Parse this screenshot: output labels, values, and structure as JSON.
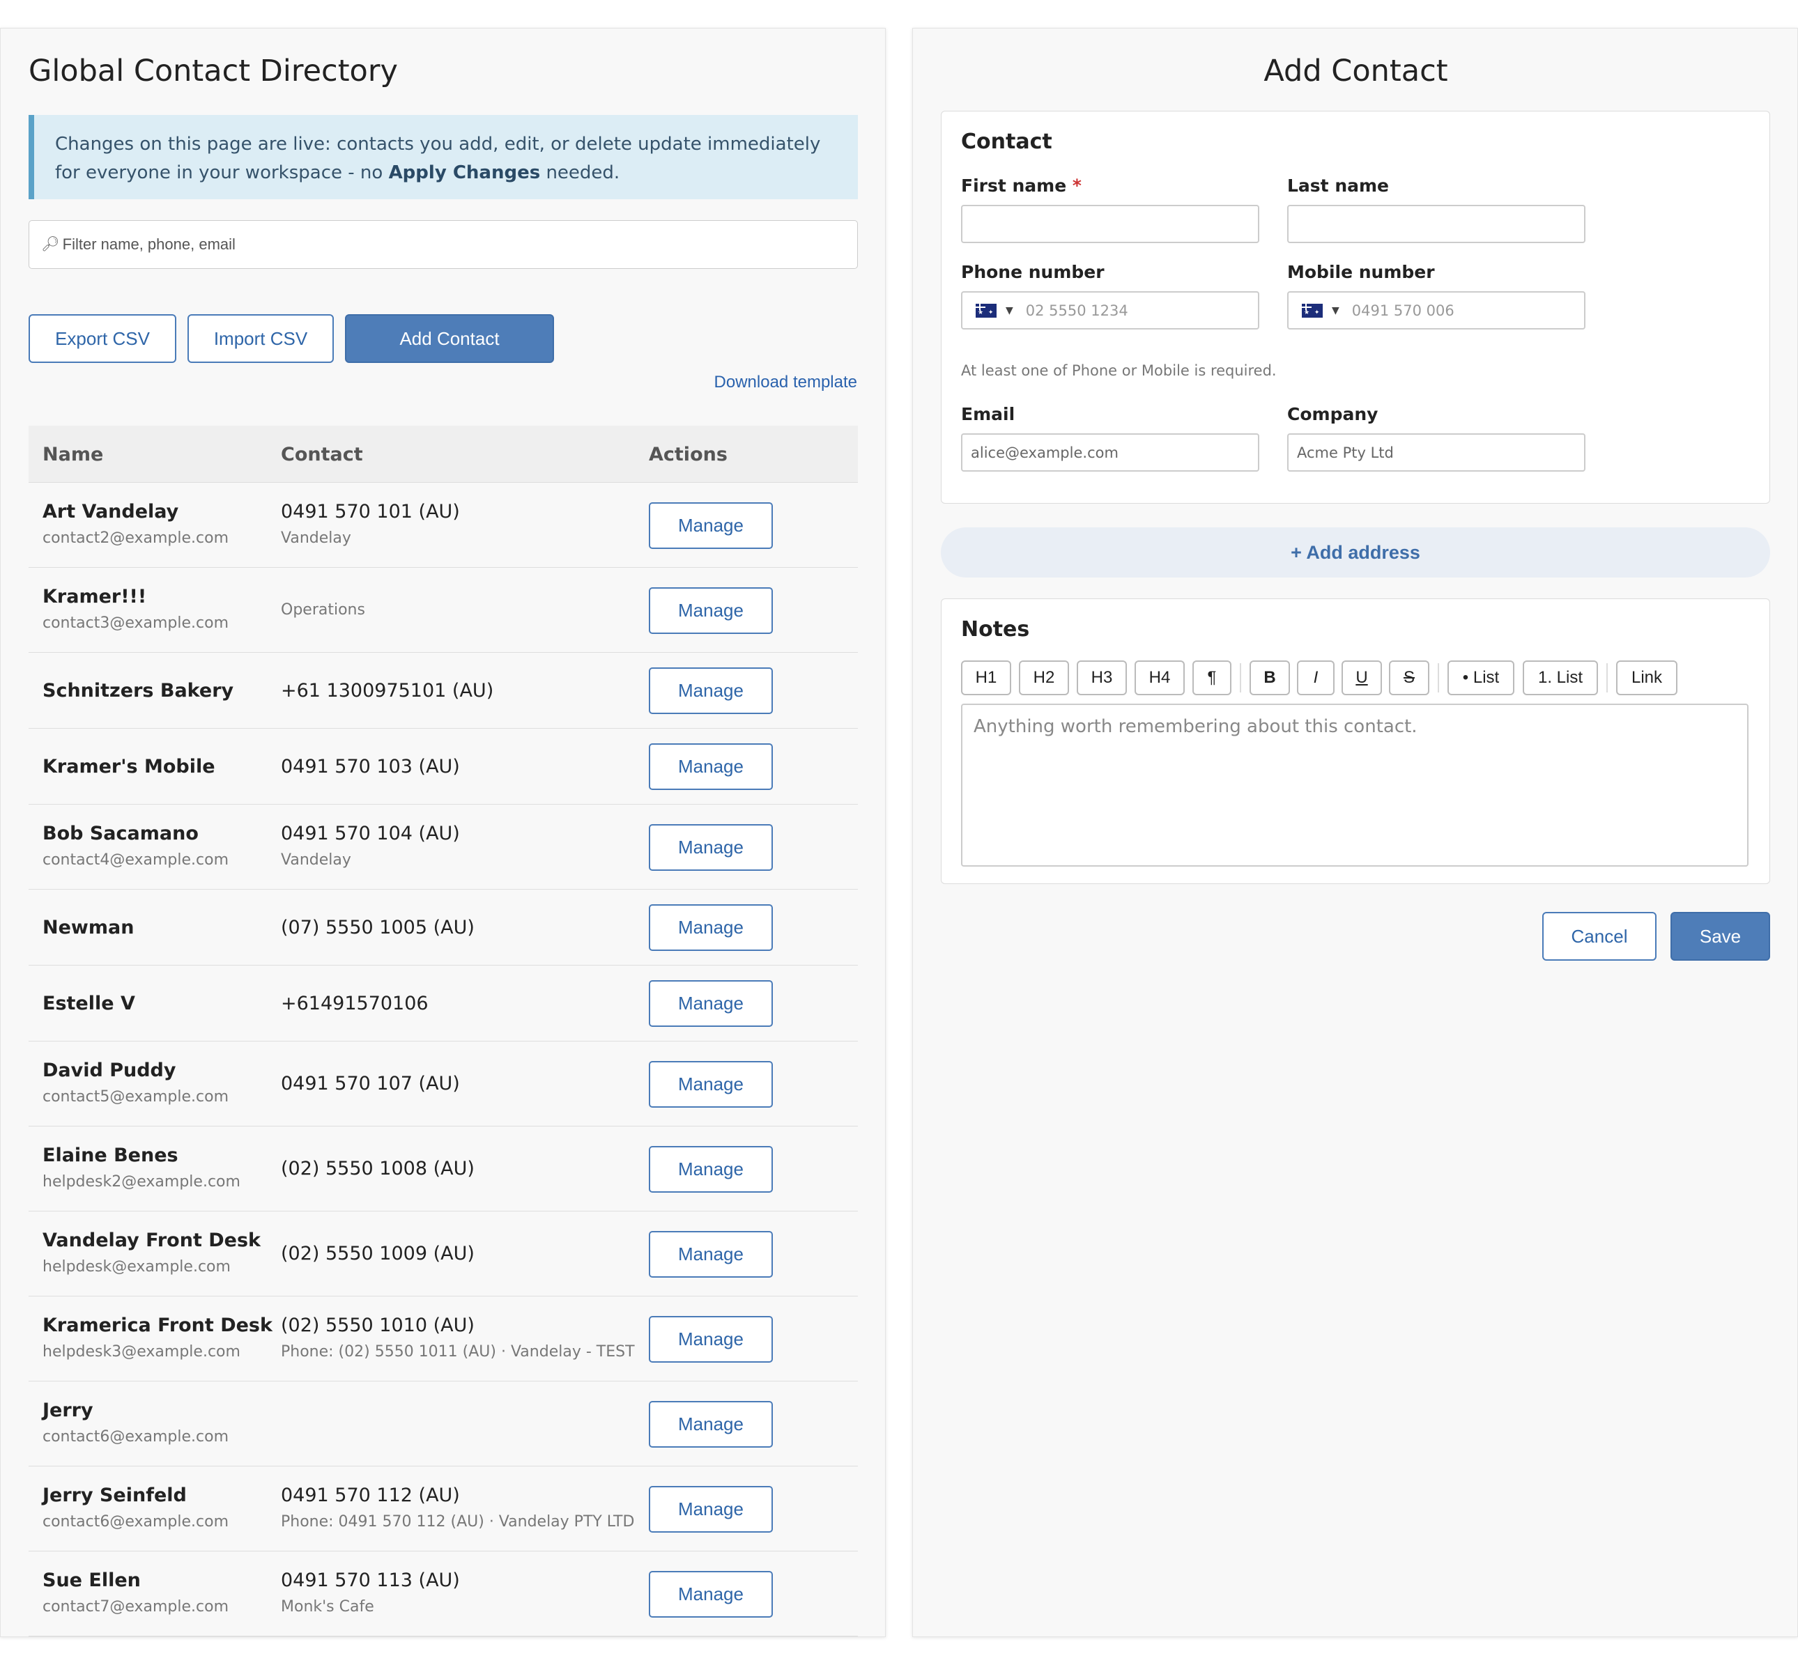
{
  "directory": {
    "title": "Global Contact Directory",
    "info": {
      "text_before": "Changes on this page are live: contacts you add, edit, or delete update immediately for everyone in your workspace - no ",
      "bold": "Apply Changes",
      "text_after": " needed."
    },
    "filter": {
      "placeholder": "Filter name, phone, email",
      "value": ""
    },
    "buttons": {
      "export": "Export CSV",
      "import": "Import CSV",
      "add": "Add Contact"
    },
    "download_template": "Download template",
    "columns": [
      "Name",
      "Contact",
      "Actions"
    ],
    "manage_label": "Manage",
    "contacts": [
      {
        "name": "Art Vandelay",
        "email": "contact2@example.com",
        "phone": "0491 570 101 (AU)",
        "detail": "Vandelay"
      },
      {
        "name": "Kramer!!!",
        "email": "contact3@example.com",
        "phone": "",
        "detail": "Operations"
      },
      {
        "name": "Schnitzers Bakery",
        "email": "",
        "phone": "+61 1300975101 (AU)",
        "detail": ""
      },
      {
        "name": "Kramer's Mobile",
        "email": "",
        "phone": "0491 570 103 (AU)",
        "detail": ""
      },
      {
        "name": "Bob Sacamano",
        "email": "contact4@example.com",
        "phone": "0491 570 104 (AU)",
        "detail": "Vandelay"
      },
      {
        "name": "Newman",
        "email": "",
        "phone": "(07) 5550 1005 (AU)",
        "detail": ""
      },
      {
        "name": "Estelle V",
        "email": "",
        "phone": "+61491570106",
        "detail": ""
      },
      {
        "name": "David Puddy",
        "email": "contact5@example.com",
        "phone": "0491 570 107 (AU)",
        "detail": ""
      },
      {
        "name": "Elaine Benes",
        "email": "helpdesk2@example.com",
        "phone": "(02) 5550 1008 (AU)",
        "detail": ""
      },
      {
        "name": "Vandelay Front Desk",
        "email": "helpdesk@example.com",
        "phone": "(02) 5550 1009 (AU)",
        "detail": ""
      },
      {
        "name": "Kramerica Front Desk",
        "email": "helpdesk3@example.com",
        "phone": "(02) 5550 1010 (AU)",
        "detail": "Phone: (02) 5550 1011 (AU) · Vandelay - TEST"
      },
      {
        "name": "Jerry",
        "email": "contact6@example.com",
        "phone": "",
        "detail": ""
      },
      {
        "name": "Jerry Seinfeld",
        "email": "contact6@example.com",
        "phone": "0491 570 112 (AU)",
        "detail": "Phone: 0491 570 112 (AU) · Vandelay PTY LTD"
      },
      {
        "name": "Sue Ellen",
        "email": "contact7@example.com",
        "phone": "0491 570 113 (AU)",
        "detail": "Monk's Cafe"
      }
    ]
  },
  "add_contact": {
    "title": "Add Contact",
    "contact_section": {
      "heading": "Contact",
      "first_name": {
        "label": "First name",
        "required_mark": "*",
        "value": ""
      },
      "last_name": {
        "label": "Last name",
        "value": ""
      },
      "phone": {
        "label": "Phone number",
        "placeholder": "02 5550 1234",
        "country_flag": "au-flag-icon"
      },
      "mobile": {
        "label": "Mobile number",
        "placeholder": "0491 570 006",
        "country_flag": "au-flag-icon"
      },
      "hint": "At least one of Phone or Mobile is required.",
      "email": {
        "label": "Email",
        "placeholder": "alice@example.com"
      },
      "company": {
        "label": "Company",
        "placeholder": "Acme Pty Ltd"
      }
    },
    "add_address": "+ Add address",
    "notes": {
      "heading": "Notes",
      "toolbar": [
        "H1",
        "H2",
        "H3",
        "H4",
        "¶",
        "B",
        "I",
        "U",
        "S",
        "• List",
        "1. List",
        "Link"
      ],
      "placeholder": "Anything worth remembering about this contact."
    },
    "buttons": {
      "cancel": "Cancel",
      "save": "Save"
    }
  },
  "colors": {
    "accent": "#4e7db8",
    "info_bg": "#dcedf5",
    "info_border": "#5aa2c8",
    "required": "#cc3333"
  }
}
